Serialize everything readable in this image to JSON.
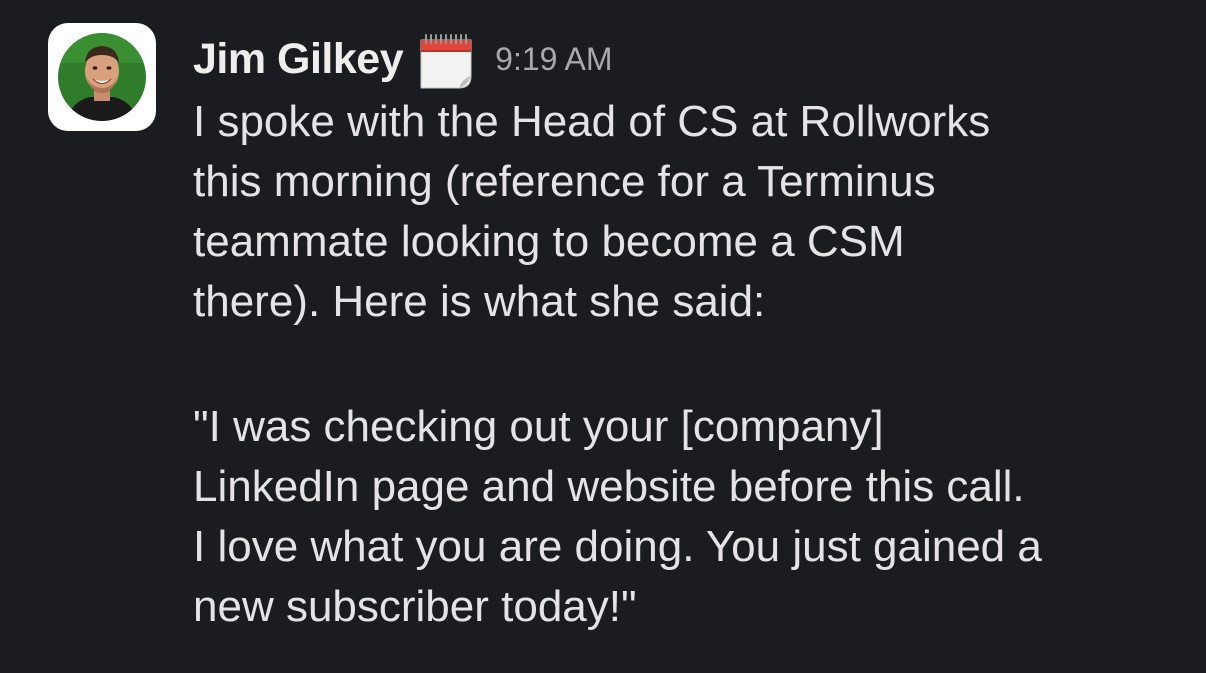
{
  "message": {
    "author": "Jim Gilkey",
    "status_icon": "calendar-icon",
    "timestamp": "9:19 AM",
    "paragraphs": [
      {
        "lines": [
          "I spoke with the Head of CS at Rollworks",
          "this morning (reference for a Terminus",
          "teammate looking to become a CSM",
          "there). Here is what she said:"
        ]
      },
      {
        "lines": [
          "\"I was checking out your [company]",
          "LinkedIn page and website before this call.",
          "I love what you are doing. You just gained a",
          "new subscriber today!\""
        ]
      }
    ]
  },
  "colors": {
    "background": "#1b1c20",
    "text": "#e4e4e6",
    "author": "#eeeeee",
    "timestamp": "#a8a9ad",
    "avatar_bg": "#2e7d32"
  }
}
